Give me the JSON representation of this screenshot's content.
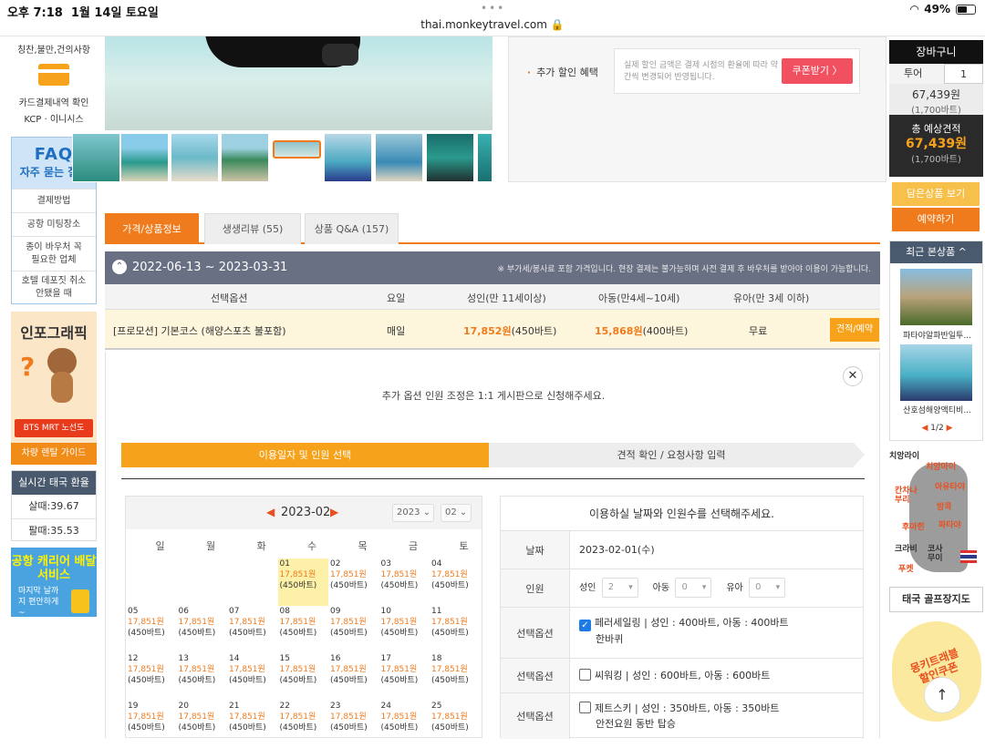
{
  "status": {
    "time": "오후 7:18",
    "date": "1월 14일 토요일",
    "url": "thai.monkeytravel.com",
    "battery": "49%"
  },
  "left": {
    "top_item": "칭찬,불만,건의사항",
    "card_check": "카드결제내역 확인",
    "card_pg": "KCP · 이니시스",
    "faq_title": "FAQ",
    "faq_sub": "자주 묻는 질문",
    "faq_items": [
      "결제방법",
      "공항 미팅장소",
      "종이 바우처 꼭 필요한 업체",
      "호텔 데포짓 취소 안됐을 때"
    ],
    "info_title": "인포그래픽",
    "bts": "BTS MRT 노선도",
    "rent": "차량 렌탈 가이드",
    "exchange_title": "실시간 태국 환율",
    "buy": "살때:39.67",
    "sell": "팔때:35.53",
    "airport_a": "공항 캐리어 배달 서비스",
    "airport_b": "마지막 날까지 편안하게~"
  },
  "promo": {
    "label": "추가 할인 혜택",
    "text": "실제 할인 금액은 결제 시점의 환율에 따라 약간씩 변경되어 반영됩니다.",
    "button": "쿠폰받기 〉"
  },
  "tabs": [
    "가격/상품정보",
    "생생리뷰 (55)",
    "상품 Q&A (157)"
  ],
  "date_range": "2022-06-13 ~ 2023-03-31",
  "date_note": "※ 부가세/봉사료 포함 가격입니다. 현장 결제는 불가능하며 사전 결제 후 바우처를 받아야 이용이 가능합니다.",
  "table": {
    "headers": [
      "선택옵션",
      "요일",
      "성인(만 11세이상)",
      "아동(만4세~10세)",
      "유아(만 3세 이하)"
    ],
    "row": {
      "option": "[프로모션] 기본코스 (해양스포츠 불포함)",
      "day": "매일",
      "adult_price": "17,852원",
      "adult_baht": "(450바트)",
      "child_price": "15,868원",
      "child_baht": "(400바트)",
      "infant": "무료",
      "button": "견적/예약"
    }
  },
  "panel": {
    "note": "추가 옵션 인원 조정은 1:1 게시판으로 신청해주세요.",
    "step1": "이용일자 및 인원 선택",
    "step2": "견적 확인 / 요청사항 입력"
  },
  "calendar": {
    "month": "2023-02",
    "year_sel": "2023",
    "month_sel": "02",
    "weekdays": [
      "일",
      "월",
      "화",
      "수",
      "목",
      "금",
      "토"
    ],
    "price": "17,851원",
    "baht": "(450바트)",
    "days": [
      "01",
      "02",
      "03",
      "04",
      "05",
      "06",
      "07",
      "08",
      "09",
      "10",
      "11",
      "12",
      "13",
      "14",
      "15",
      "16",
      "17",
      "18",
      "19",
      "20",
      "21",
      "22",
      "23",
      "24",
      "25"
    ]
  },
  "form": {
    "title": "이용하실 날짜와 인원수를 선택해주세요.",
    "date_label": "날짜",
    "date_value": "2023-02-01(수)",
    "people_label": "인원",
    "adult": "성인",
    "adult_val": "2",
    "child": "아동",
    "child_val": "0",
    "infant": "유아",
    "infant_val": "0",
    "option_label": "선택옵션",
    "opt1": "페러세일링 | 성인 : 400바트, 아동 : 400바트",
    "opt1b": "한바퀴",
    "opt2": "씨워킹 | 성인 : 600바트, 아동 : 600바트",
    "opt3": "제트스키 | 성인 : 350바트, 아동 : 350바트",
    "opt3b": "안전요원 동반 탑승"
  },
  "cart": {
    "title": "장바구니",
    "item": "투어",
    "qty": "1",
    "price": "67,439원",
    "baht": "(1,700바트)",
    "total_label": "총 예상견적",
    "total": "67,439원",
    "total_baht": "(1,700바트)",
    "view": "담은상품 보기",
    "reserve": "예약하기"
  },
  "recent": {
    "title": "최근 본상품 ^",
    "item1": "파타야알파반일투...",
    "item2": "산호섬해양액티비...",
    "page": "1/2"
  },
  "map": {
    "title": "치앙라이",
    "labels": [
      "치앙마이",
      "아유타야",
      "칸차나부리",
      "방콕",
      "파타야",
      "후아힌",
      "크라비",
      "코사무이",
      "푸켓"
    ],
    "golf": "태국 골프장지도"
  },
  "coupon": {
    "text": "몽키트래블 할인쿠폰"
  }
}
